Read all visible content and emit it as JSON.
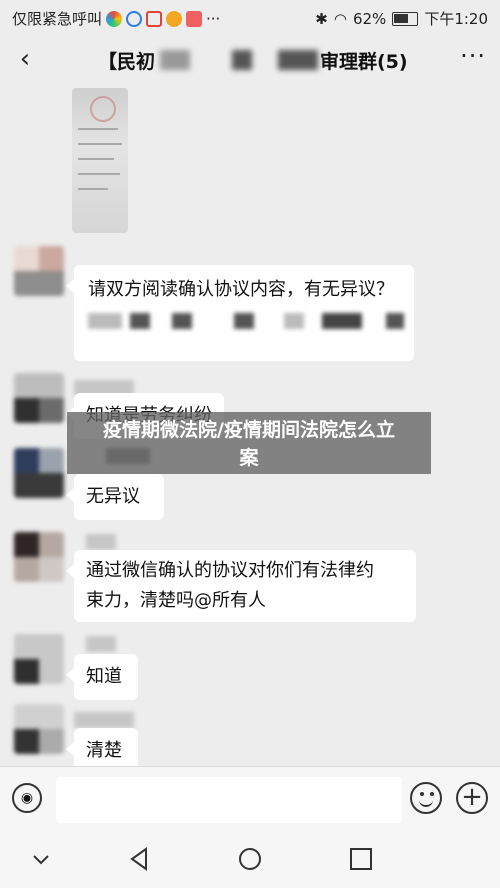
{
  "status_bar": {
    "carrier": "仅限紧急呼叫",
    "more": "···",
    "battery": "62%",
    "time": "下午1:20"
  },
  "header": {
    "back_icon": "chevron-left-icon",
    "title_left": "【民初",
    "title_right": "审理群(5)",
    "more_label": "···"
  },
  "messages": [
    {
      "type": "image",
      "description_icon": "document-photo"
    },
    {
      "type": "text",
      "text": "请双方阅读确认协议内容，有无异议？"
    },
    {
      "type": "text",
      "text": "知道是劳务纠纷"
    },
    {
      "type": "text",
      "text": "无异议"
    },
    {
      "type": "text",
      "text_line1": "通过微信确认的协议对你们有法律约",
      "text_line2": "束力，清楚吗@所有人"
    },
    {
      "type": "text",
      "text": "知道"
    },
    {
      "type": "text",
      "text": "清楚"
    }
  ],
  "overlay": {
    "line1": "疫情期微法院/疫情期间法院怎么立",
    "line2": "案"
  },
  "input_bar": {
    "voice_icon": "voice-icon",
    "emoji_icon": "emoji-icon",
    "plus_icon": "plus-icon",
    "placeholder": ""
  },
  "nav": {
    "down_icon": "chevron-down-icon",
    "back_icon": "triangle-back-icon",
    "home_icon": "circle-home-icon",
    "recent_icon": "square-recent-icon"
  }
}
